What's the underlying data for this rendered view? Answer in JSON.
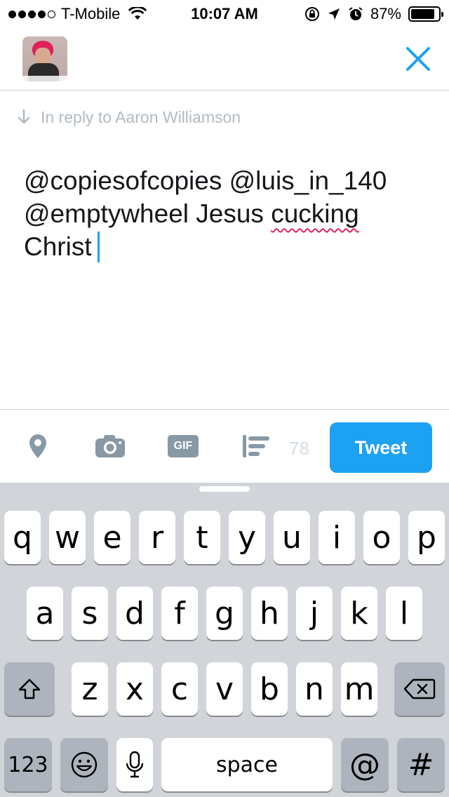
{
  "status_bar": {
    "carrier": "T-Mobile",
    "time": "10:07 AM",
    "battery": "87%",
    "battery_level": 0.87
  },
  "header": {
    "avatar_alt": "profile avatar"
  },
  "reply": {
    "text": "In reply to Aaron Williamson"
  },
  "compose": {
    "line1": "@copiesofcopies @luis_in_140",
    "line2_prefix": "@emptywheel Jesus ",
    "line2_misspelled": "cucking",
    "line3": "Christ"
  },
  "toolbar": {
    "char_count": "78",
    "gif_label": "GIF",
    "tweet_label": "Tweet"
  },
  "keyboard": {
    "row1": [
      "q",
      "w",
      "e",
      "r",
      "t",
      "y",
      "u",
      "i",
      "o",
      "p"
    ],
    "row2": [
      "a",
      "s",
      "d",
      "f",
      "g",
      "h",
      "j",
      "k",
      "l"
    ],
    "row3": [
      "z",
      "x",
      "c",
      "v",
      "b",
      "n",
      "m"
    ],
    "numbers_label": "123",
    "space_label": "space",
    "at_label": "@",
    "hash_label": "#"
  },
  "colors": {
    "accent": "#1da1f2",
    "keyboard_bg": "#d1d4d9",
    "toolbar_icon": "#8899a6"
  }
}
